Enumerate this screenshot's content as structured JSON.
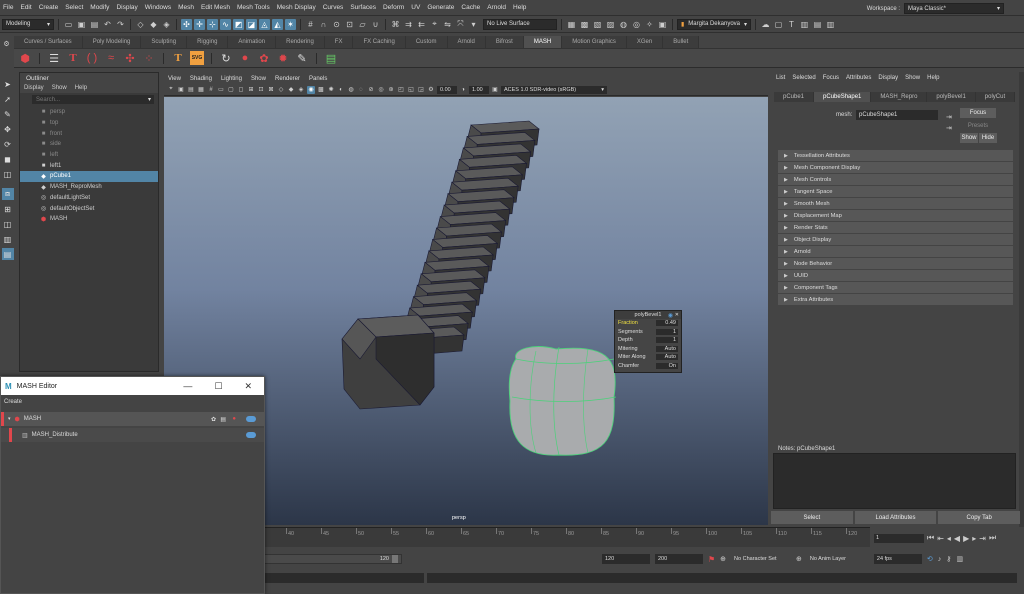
{
  "menubar": {
    "items": [
      "File",
      "Edit",
      "Create",
      "Select",
      "Modify",
      "Display",
      "Windows",
      "Mesh",
      "Edit Mesh",
      "Mesh Tools",
      "Mesh Display",
      "Curves",
      "Surfaces",
      "Deform",
      "UV",
      "Generate",
      "Cache",
      "Arnold",
      "Help"
    ],
    "workspace_label": "Workspace :",
    "workspace_value": "Maya Classic*"
  },
  "statusline": {
    "mode_select": "Modeling",
    "live_surface": "No Live Surface",
    "user": "Margita Dekanyova"
  },
  "shelf": {
    "tabs": [
      "Curves / Surfaces",
      "Poly Modeling",
      "Sculpting",
      "Rigging",
      "Animation",
      "Rendering",
      "FX",
      "FX Caching",
      "Custom",
      "Arnold",
      "Bifrost",
      "MASH",
      "Motion Graphics",
      "XGen",
      "Bullet"
    ],
    "active_tab": "MASH"
  },
  "outliner": {
    "title": "Outliner",
    "menu": [
      "Display",
      "Show",
      "Help"
    ],
    "search_placeholder": "Search...",
    "items": [
      {
        "label": "persp",
        "icon": "camera-icon",
        "dim": true
      },
      {
        "label": "top",
        "icon": "camera-icon",
        "dim": true
      },
      {
        "label": "front",
        "icon": "camera-icon",
        "dim": true
      },
      {
        "label": "side",
        "icon": "camera-icon",
        "dim": true
      },
      {
        "label": "left",
        "icon": "camera-icon",
        "dim": true
      },
      {
        "label": "left1",
        "icon": "camera-icon",
        "dim": false
      },
      {
        "label": "pCube1",
        "icon": "mesh-icon",
        "dim": false,
        "selected": true
      },
      {
        "label": "MASH_ReproMesh",
        "icon": "mesh-icon",
        "dim": false
      },
      {
        "label": "defaultLightSet",
        "icon": "set-icon",
        "dim": false
      },
      {
        "label": "defaultObjectSet",
        "icon": "set-icon",
        "dim": false
      },
      {
        "label": "MASH",
        "icon": "mash-icon",
        "dim": false
      }
    ]
  },
  "viewport": {
    "menu": [
      "View",
      "Shading",
      "Lighting",
      "Show",
      "Renderer",
      "Panels"
    ],
    "exposure": "0.00",
    "gamma": "1.00",
    "color_space": "ACES 1.0 SDR-video (sRGB)",
    "camera": "persp"
  },
  "polybevel": {
    "title": "polyBevel1",
    "rows": [
      {
        "label": "Fraction",
        "value": "0.49",
        "highlight": true
      },
      {
        "label": "Segments",
        "value": "1"
      },
      {
        "label": "Depth",
        "value": "1"
      },
      {
        "label": "Mitering",
        "value": "Auto"
      },
      {
        "label": "Miter Along",
        "value": "Auto"
      },
      {
        "label": "Chamfer",
        "value": "On"
      }
    ]
  },
  "attr": {
    "menu": [
      "List",
      "Selected",
      "Focus",
      "Attributes",
      "Display",
      "Show",
      "Help"
    ],
    "tabs": [
      "pCube1",
      "pCubeShape1",
      "MASH_Repro",
      "polyBevel1",
      "polyCut"
    ],
    "active_tab": "pCubeShape1",
    "mesh_label": "mesh:",
    "mesh_value": "pCubeShape1",
    "focus": "Focus",
    "presets": "Presets",
    "show": "Show",
    "hide": "Hide",
    "sections": [
      "Tessellation Attributes",
      "Mesh Component Display",
      "Mesh Controls",
      "Tangent Space",
      "Smooth Mesh",
      "Displacement Map",
      "Render Stats",
      "Object Display",
      "Arnold",
      "Node Behavior",
      "UUID",
      "Component Tags",
      "Extra Attributes"
    ],
    "notes_label": "Notes: pCubeShape1",
    "buttons": [
      "Select",
      "Load Attributes",
      "Copy Tab"
    ]
  },
  "timeline": {
    "ticks": [
      "40",
      "45",
      "50",
      "55",
      "60",
      "65",
      "70",
      "75",
      "80",
      "85",
      "90",
      "95",
      "100",
      "105",
      "110",
      "115",
      "120"
    ],
    "current_frame": "1"
  },
  "range": {
    "end_marker": "120",
    "anim_end": "120",
    "total_end": "200",
    "character_set": "No Character Set",
    "anim_layer": "No Anim Layer",
    "fps": "24 fps"
  },
  "mash_editor": {
    "title": "MASH Editor",
    "create": "Create",
    "network": "MASH",
    "node": "MASH_Distribute",
    "accent": "#e0474c"
  }
}
